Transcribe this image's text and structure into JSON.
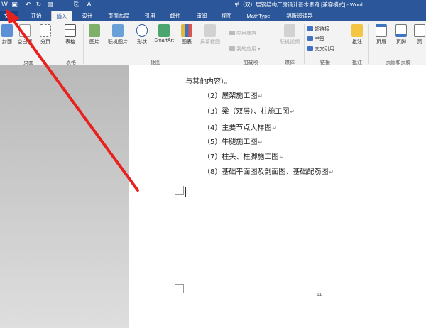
{
  "titlebar": {
    "title": "单（双）层钢结构厂房设计基本思路 [兼容模式] - Word",
    "qa_icons": [
      "word-icon",
      "save-icon",
      "undo-icon",
      "redo-icon",
      "print-preview-icon",
      "paste-icon",
      "style-icon"
    ]
  },
  "tabs": {
    "file": "文件",
    "items": [
      "开始",
      "插入",
      "设计",
      "页面布局",
      "引用",
      "邮件",
      "审阅",
      "视图",
      "MathType",
      "福昕阅读器"
    ],
    "active_index": 1
  },
  "ribbon": {
    "pages": {
      "cover": "封面",
      "blank": "空白页",
      "break": "分页",
      "group": "页面"
    },
    "tables": {
      "table": "表格",
      "group": "表格"
    },
    "illustrations": {
      "picture": "图片",
      "online_picture": "联机图片",
      "shapes": "形状",
      "smartart": "SmartArt",
      "chart": "图表",
      "screenshot": "屏幕截图",
      "group": "插图"
    },
    "addins": {
      "store": "应用商店",
      "my_apps": "我的应用",
      "group": "加载项"
    },
    "media": {
      "online_video": "联机视频",
      "group": "媒体"
    },
    "links": {
      "hyperlink": "超链接",
      "bookmark": "书签",
      "cross_ref": "交叉引用",
      "group": "链接"
    },
    "comments": {
      "comment": "批注",
      "group": "批注"
    },
    "header_footer": {
      "header": "页眉",
      "footer": "页脚",
      "page_number": "页",
      "group": "页眉和页脚"
    }
  },
  "document": {
    "lines": [
      "与其他内容）。",
      "（2）屋架施工图",
      "（3）梁（双层）、柱施工图",
      "（4）主要节点大样图",
      "（5）牛腿施工图",
      "（7）柱头、柱脚施工图",
      "（8）基础平面图及剖面图、基础配筋图"
    ],
    "page_number": "11"
  },
  "colors": {
    "accent": "#2b579a",
    "arrow": "#e8201e"
  }
}
